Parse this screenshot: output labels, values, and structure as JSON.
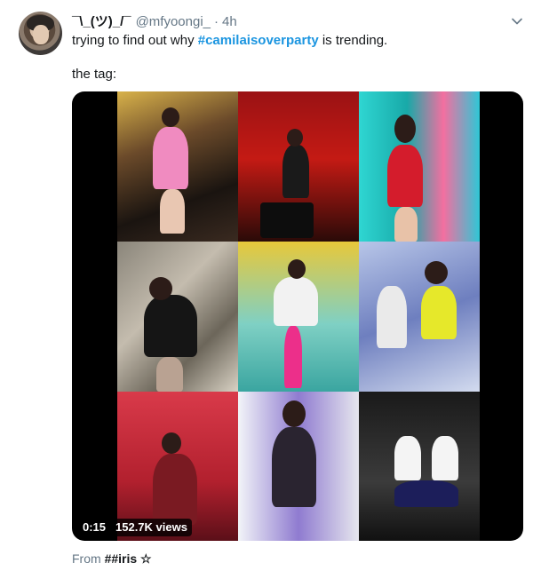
{
  "tweet": {
    "display_name": "¯\\_(ツ)_/¯",
    "handle": "@mfyoongi_",
    "separator": "·",
    "time": "4h",
    "text_prefix": "trying to find out why ",
    "hashtag": "#camilaisoverparty",
    "text_suffix": " is trending.",
    "line2": "the tag:"
  },
  "media": {
    "duration": "0:15",
    "views": "152.7K views"
  },
  "source": {
    "prefix": "From ",
    "name": "##iris ☆"
  },
  "icons": {
    "menu": "chevron-down-icon"
  }
}
